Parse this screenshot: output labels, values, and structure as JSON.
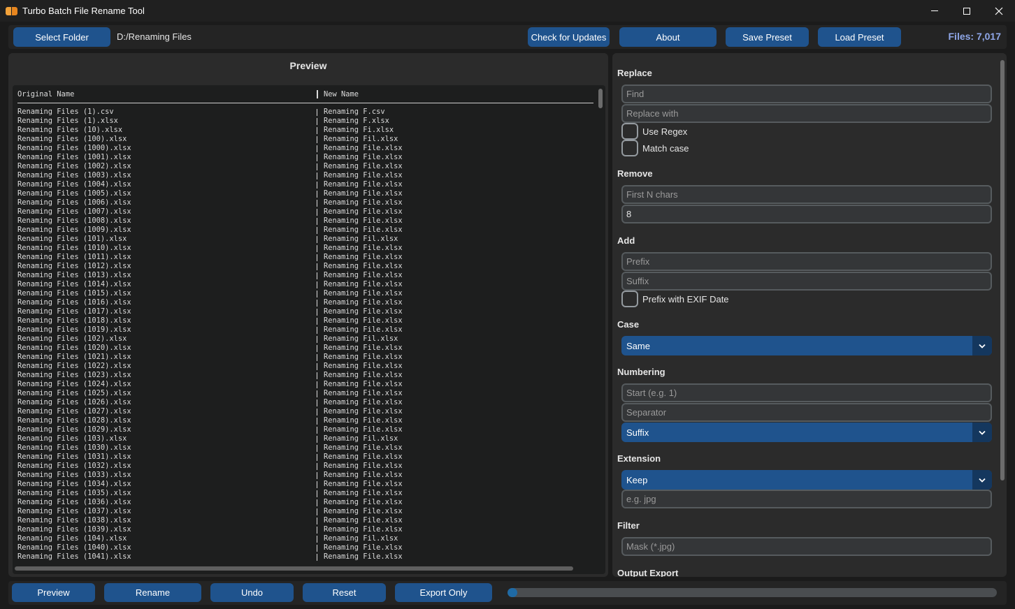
{
  "window": {
    "title": "Turbo Batch File Rename Tool"
  },
  "toolbar": {
    "select_folder": "Select Folder",
    "folder_path": "D:/Renaming Files",
    "check_updates": "Check for Updates",
    "about": "About",
    "save_preset": "Save Preset",
    "load_preset": "Load Preset",
    "files_count": "Files: 7,017"
  },
  "preview": {
    "title": "Preview",
    "col_original": "Original Name",
    "col_new": "New Name",
    "rows": [
      {
        "original": "Renaming Files (1).csv",
        "new": "Renaming F.csv"
      },
      {
        "original": "Renaming Files (1).xlsx",
        "new": "Renaming F.xlsx"
      },
      {
        "original": "Renaming Files (10).xlsx",
        "new": "Renaming Fi.xlsx"
      },
      {
        "original": "Renaming Files (100).xlsx",
        "new": "Renaming Fil.xlsx"
      },
      {
        "original": "Renaming Files (1000).xlsx",
        "new": "Renaming File.xlsx"
      },
      {
        "original": "Renaming Files (1001).xlsx",
        "new": "Renaming File.xlsx"
      },
      {
        "original": "Renaming Files (1002).xlsx",
        "new": "Renaming File.xlsx"
      },
      {
        "original": "Renaming Files (1003).xlsx",
        "new": "Renaming File.xlsx"
      },
      {
        "original": "Renaming Files (1004).xlsx",
        "new": "Renaming File.xlsx"
      },
      {
        "original": "Renaming Files (1005).xlsx",
        "new": "Renaming File.xlsx"
      },
      {
        "original": "Renaming Files (1006).xlsx",
        "new": "Renaming File.xlsx"
      },
      {
        "original": "Renaming Files (1007).xlsx",
        "new": "Renaming File.xlsx"
      },
      {
        "original": "Renaming Files (1008).xlsx",
        "new": "Renaming File.xlsx"
      },
      {
        "original": "Renaming Files (1009).xlsx",
        "new": "Renaming File.xlsx"
      },
      {
        "original": "Renaming Files (101).xlsx",
        "new": "Renaming Fil.xlsx"
      },
      {
        "original": "Renaming Files (1010).xlsx",
        "new": "Renaming File.xlsx"
      },
      {
        "original": "Renaming Files (1011).xlsx",
        "new": "Renaming File.xlsx"
      },
      {
        "original": "Renaming Files (1012).xlsx",
        "new": "Renaming File.xlsx"
      },
      {
        "original": "Renaming Files (1013).xlsx",
        "new": "Renaming File.xlsx"
      },
      {
        "original": "Renaming Files (1014).xlsx",
        "new": "Renaming File.xlsx"
      },
      {
        "original": "Renaming Files (1015).xlsx",
        "new": "Renaming File.xlsx"
      },
      {
        "original": "Renaming Files (1016).xlsx",
        "new": "Renaming File.xlsx"
      },
      {
        "original": "Renaming Files (1017).xlsx",
        "new": "Renaming File.xlsx"
      },
      {
        "original": "Renaming Files (1018).xlsx",
        "new": "Renaming File.xlsx"
      },
      {
        "original": "Renaming Files (1019).xlsx",
        "new": "Renaming File.xlsx"
      },
      {
        "original": "Renaming Files (102).xlsx",
        "new": "Renaming Fil.xlsx"
      },
      {
        "original": "Renaming Files (1020).xlsx",
        "new": "Renaming File.xlsx"
      },
      {
        "original": "Renaming Files (1021).xlsx",
        "new": "Renaming File.xlsx"
      },
      {
        "original": "Renaming Files (1022).xlsx",
        "new": "Renaming File.xlsx"
      },
      {
        "original": "Renaming Files (1023).xlsx",
        "new": "Renaming File.xlsx"
      },
      {
        "original": "Renaming Files (1024).xlsx",
        "new": "Renaming File.xlsx"
      },
      {
        "original": "Renaming Files (1025).xlsx",
        "new": "Renaming File.xlsx"
      },
      {
        "original": "Renaming Files (1026).xlsx",
        "new": "Renaming File.xlsx"
      },
      {
        "original": "Renaming Files (1027).xlsx",
        "new": "Renaming File.xlsx"
      },
      {
        "original": "Renaming Files (1028).xlsx",
        "new": "Renaming File.xlsx"
      },
      {
        "original": "Renaming Files (1029).xlsx",
        "new": "Renaming File.xlsx"
      },
      {
        "original": "Renaming Files (103).xlsx",
        "new": "Renaming Fil.xlsx"
      },
      {
        "original": "Renaming Files (1030).xlsx",
        "new": "Renaming File.xlsx"
      },
      {
        "original": "Renaming Files (1031).xlsx",
        "new": "Renaming File.xlsx"
      },
      {
        "original": "Renaming Files (1032).xlsx",
        "new": "Renaming File.xlsx"
      },
      {
        "original": "Renaming Files (1033).xlsx",
        "new": "Renaming File.xlsx"
      },
      {
        "original": "Renaming Files (1034).xlsx",
        "new": "Renaming File.xlsx"
      },
      {
        "original": "Renaming Files (1035).xlsx",
        "new": "Renaming File.xlsx"
      },
      {
        "original": "Renaming Files (1036).xlsx",
        "new": "Renaming File.xlsx"
      },
      {
        "original": "Renaming Files (1037).xlsx",
        "new": "Renaming File.xlsx"
      },
      {
        "original": "Renaming Files (1038).xlsx",
        "new": "Renaming File.xlsx"
      },
      {
        "original": "Renaming Files (1039).xlsx",
        "new": "Renaming File.xlsx"
      },
      {
        "original": "Renaming Files (104).xlsx",
        "new": "Renaming Fil.xlsx"
      },
      {
        "original": "Renaming Files (1040).xlsx",
        "new": "Renaming File.xlsx"
      },
      {
        "original": "Renaming Files (1041).xlsx",
        "new": "Renaming File.xlsx"
      }
    ]
  },
  "options": {
    "replace": {
      "title": "Replace",
      "find_placeholder": "Find",
      "replace_placeholder": "Replace with",
      "use_regex": "Use Regex",
      "match_case": "Match case"
    },
    "remove": {
      "title": "Remove",
      "first_n_placeholder": "First N chars",
      "count_value": "8"
    },
    "add": {
      "title": "Add",
      "prefix_placeholder": "Prefix",
      "suffix_placeholder": "Suffix",
      "exif_label": "Prefix with EXIF Date"
    },
    "case": {
      "title": "Case",
      "selected": "Same"
    },
    "numbering": {
      "title": "Numbering",
      "start_placeholder": "Start (e.g. 1)",
      "separator_placeholder": "Separator",
      "position_selected": "Suffix"
    },
    "extension": {
      "title": "Extension",
      "mode_selected": "Keep",
      "ext_placeholder": "e.g. jpg"
    },
    "filter": {
      "title": "Filter",
      "mask_placeholder": "Mask (*.jpg)"
    },
    "output_export": {
      "title": "Output Export"
    }
  },
  "bottom": {
    "preview": "Preview",
    "rename": "Rename",
    "undo": "Undo",
    "reset": "Reset",
    "export_only": "Export Only",
    "progress": 0.02
  },
  "colors": {
    "accent": "#1f538d",
    "files_count": "#8fa7e8",
    "progress_fill": "#1f6aa5"
  }
}
